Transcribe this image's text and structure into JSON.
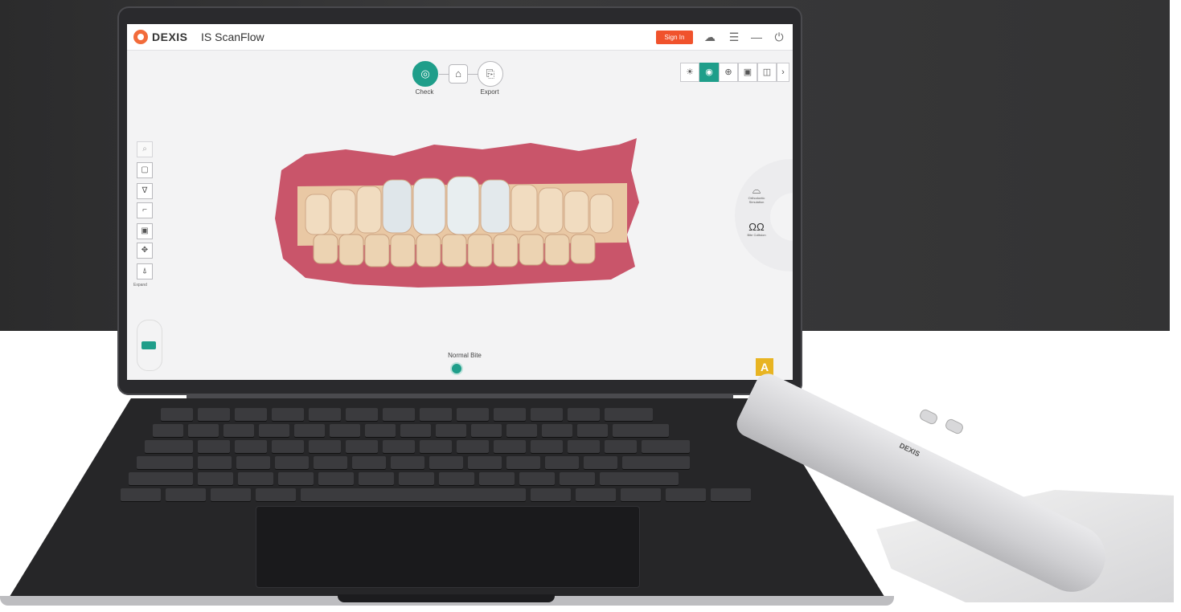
{
  "app": {
    "brand": "DEXIS",
    "name": "IS ScanFlow",
    "sign_in_label": "Sign In"
  },
  "titlebar_icons": [
    "cloud-icon",
    "menu-icon",
    "minimize-icon",
    "power-icon"
  ],
  "workflow": {
    "steps": [
      {
        "label": "Check",
        "icon": "check-scan-icon",
        "active": true
      },
      {
        "label": "",
        "icon": "tooth-scan-icon",
        "active": false
      },
      {
        "label": "Export",
        "icon": "export-icon",
        "active": false
      }
    ]
  },
  "view_tools": [
    "brightness-icon",
    "color-icon",
    "zoom-icon",
    "snapshot-icon",
    "view-cube-icon",
    "chevron-right-icon"
  ],
  "left_tools": [
    "select-icon",
    "tooth-icon",
    "margin-icon",
    "trim-icon",
    "snapshot-icon",
    "move-icon",
    "axis-icon"
  ],
  "left_expand_label": "Expand",
  "radial_menu": {
    "items": [
      {
        "label": "Orthodontic Simulation",
        "icon": "ortho-icon"
      },
      {
        "label": "Bite Collision",
        "icon": "bite-icon"
      }
    ]
  },
  "bite_mode": "Normal Bite",
  "corner_badge": "A",
  "scanner_brand": "DEXIS",
  "colors": {
    "accent": "#1f9e8a",
    "sign_in": "#f0522c",
    "badge": "#e8b422",
    "brand_logo": "#f26b3a"
  }
}
